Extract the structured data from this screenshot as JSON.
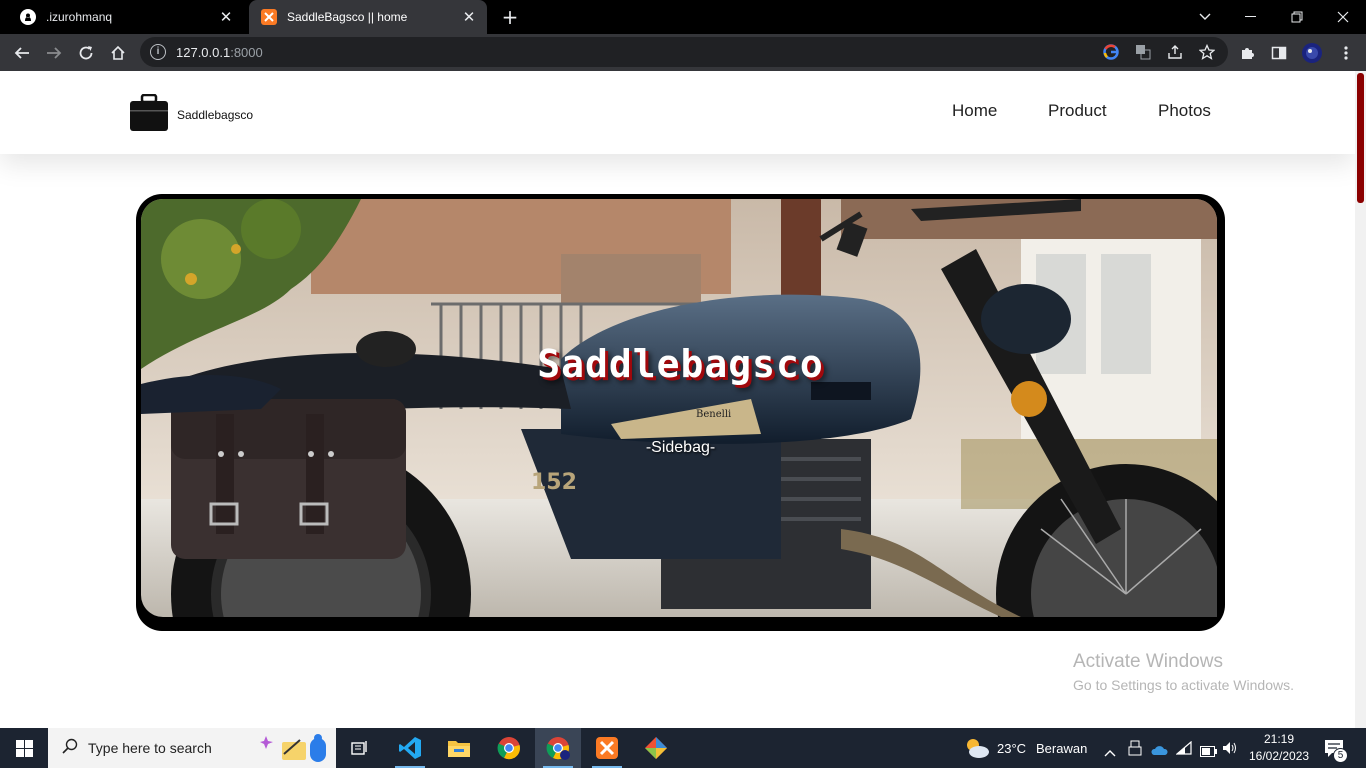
{
  "browser": {
    "tabs": [
      {
        "title": ".izurohmanq",
        "active": false
      },
      {
        "title": "SaddleBagsco || home",
        "active": true
      }
    ],
    "url": {
      "host": "127.0.0.1",
      "port": ":8000"
    }
  },
  "site": {
    "brand": "Saddlebagsco",
    "nav": [
      "Home",
      "Product",
      "Photos"
    ],
    "hero": {
      "title": "Saddlebagsco",
      "subtitle": "-Sidebag-"
    }
  },
  "watermark": {
    "line1": "Activate Windows",
    "line2": "Go to Settings to activate Windows."
  },
  "taskbar": {
    "search_placeholder": "Type here to search",
    "weather": {
      "temp": "23°C",
      "condition": "Berawan"
    },
    "clock": {
      "time": "21:19",
      "date": "16/02/2023"
    },
    "notifications": "5"
  },
  "colors": {
    "accent": "#a0080c",
    "chrome_bg": "#35363a",
    "taskbar_bg": "#1c2431"
  }
}
